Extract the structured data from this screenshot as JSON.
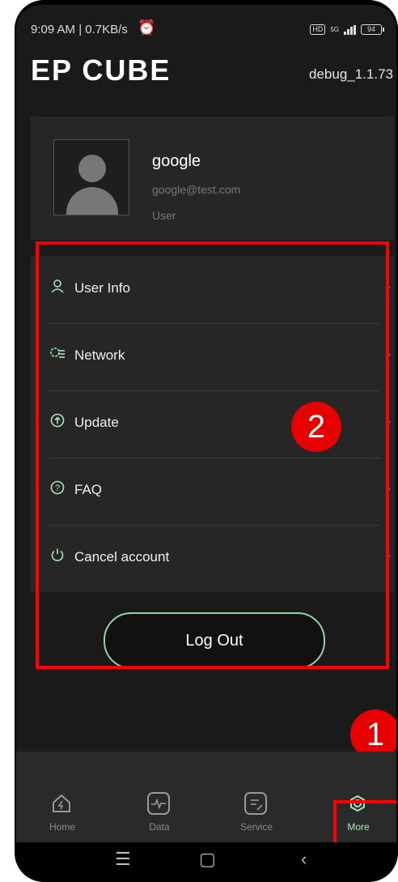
{
  "status": {
    "time": "9:09 AM | 0.7KB/s",
    "hd": "HD",
    "network": "5G",
    "battery": "94"
  },
  "header": {
    "logo": "EP CUBE",
    "version": "debug_1.1.73"
  },
  "profile": {
    "name": "google",
    "email": "google@test.com",
    "role": "User"
  },
  "menu": {
    "items": [
      {
        "label": "User Info",
        "icon": "user-icon"
      },
      {
        "label": "Network",
        "icon": "network-icon"
      },
      {
        "label": "Update",
        "icon": "update-icon"
      },
      {
        "label": "FAQ",
        "icon": "faq-icon"
      },
      {
        "label": "Cancel account",
        "icon": "power-icon"
      }
    ],
    "chevron": "›"
  },
  "logout_label": "Log Out",
  "annotations": {
    "badge_1": "1",
    "badge_2": "2"
  },
  "nav": {
    "items": [
      {
        "label": "Home",
        "icon": "home-icon"
      },
      {
        "label": "Data",
        "icon": "data-icon"
      },
      {
        "label": "Service",
        "icon": "service-icon"
      },
      {
        "label": "More",
        "icon": "gear-icon"
      }
    ],
    "active": "More"
  },
  "system_bar": {
    "menu": "☰",
    "home": "▢",
    "back": "‹"
  },
  "colors": {
    "accent": "#a8e6b8",
    "annotation": "#ff0000",
    "background": "#1a1a1a",
    "card": "#262626"
  }
}
